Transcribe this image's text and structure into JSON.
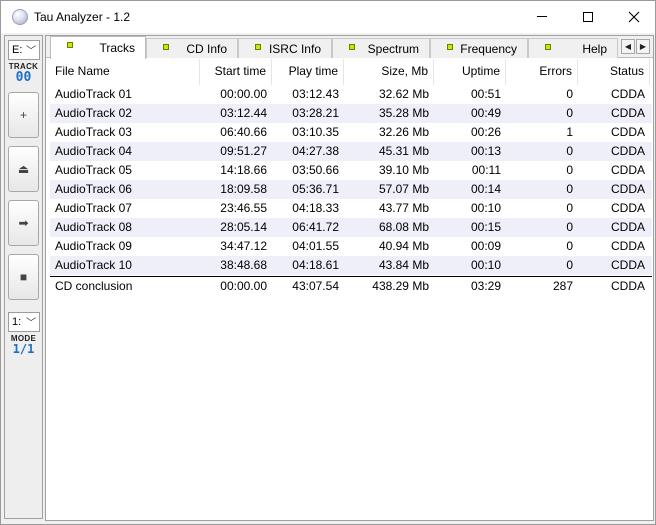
{
  "window": {
    "title": "Tau Analyzer - 1.2"
  },
  "leftbar": {
    "drive_combo": "E:",
    "track_label": "TRACK",
    "track_value": "00",
    "buttons": [
      {
        "icon": "plus-icon",
        "glyph": "+"
      },
      {
        "icon": "eject-icon",
        "glyph": "⏏"
      },
      {
        "icon": "next-arrow-icon",
        "glyph": "➡"
      },
      {
        "icon": "stop-icon",
        "glyph": "■"
      }
    ],
    "mode_combo": "1:",
    "mode_label": "MODE",
    "mode_value": "1/1"
  },
  "tabs": [
    {
      "label": "Tracks",
      "active": true
    },
    {
      "label": "CD Info"
    },
    {
      "label": "ISRC Info"
    },
    {
      "label": "Spectrum"
    },
    {
      "label": "Frequency"
    },
    {
      "label": "Help"
    }
  ],
  "table": {
    "headers": [
      "File Name",
      "Start time",
      "Play time",
      "Size, Mb",
      "Uptime",
      "Errors",
      "Status"
    ],
    "rows": [
      [
        "AudioTrack 01",
        "00:00.00",
        "03:12.43",
        "32.62 Mb",
        "00:51",
        "0",
        "CDDA"
      ],
      [
        "AudioTrack 02",
        "03:12.44",
        "03:28.21",
        "35.28 Mb",
        "00:49",
        "0",
        "CDDA"
      ],
      [
        "AudioTrack 03",
        "06:40.66",
        "03:10.35",
        "32.26 Mb",
        "00:26",
        "1",
        "CDDA"
      ],
      [
        "AudioTrack 04",
        "09:51.27",
        "04:27.38",
        "45.31 Mb",
        "00:13",
        "0",
        "CDDA"
      ],
      [
        "AudioTrack 05",
        "14:18.66",
        "03:50.66",
        "39.10 Mb",
        "00:11",
        "0",
        "CDDA"
      ],
      [
        "AudioTrack 06",
        "18:09.58",
        "05:36.71",
        "57.07 Mb",
        "00:14",
        "0",
        "CDDA"
      ],
      [
        "AudioTrack 07",
        "23:46.55",
        "04:18.33",
        "43.77 Mb",
        "00:10",
        "0",
        "CDDA"
      ],
      [
        "AudioTrack 08",
        "28:05.14",
        "06:41.72",
        "68.08 Mb",
        "00:15",
        "0",
        "CDDA"
      ],
      [
        "AudioTrack 09",
        "34:47.12",
        "04:01.55",
        "40.94 Mb",
        "00:09",
        "0",
        "CDDA"
      ],
      [
        "AudioTrack 10",
        "38:48.68",
        "04:18.61",
        "43.84 Mb",
        "00:10",
        "0",
        "CDDA"
      ]
    ],
    "total": [
      "CD conclusion",
      "00:00.00",
      "43:07.54",
      "438.29 Mb",
      "03:29",
      "287",
      "CDDA"
    ]
  },
  "colors": {
    "row_alt": "#efeff9",
    "tab_led": "#c8e800",
    "counter_blue": "#1c6fc4"
  }
}
